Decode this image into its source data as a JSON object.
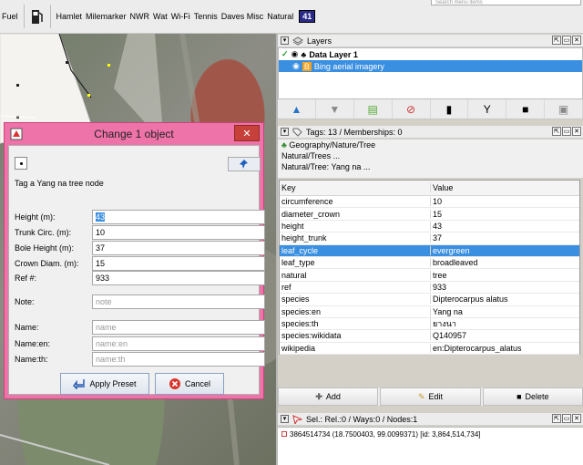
{
  "toolbar": {
    "items": [
      "Fuel",
      "Hamlet",
      "Milemarker",
      "NWR",
      "Wat",
      "Wi-Fi",
      "Tennis",
      "Daves Misc",
      "Natural"
    ],
    "badge": "41",
    "search_placeholder": "Search menu items"
  },
  "dialog": {
    "title": "Change 1 object",
    "close": "✕",
    "description": "Tag a Yang na tree node",
    "fields": [
      {
        "label": "Height (m):",
        "value": "43"
      },
      {
        "label": "Trunk Circ. (m):",
        "value": "10"
      },
      {
        "label": "Bole Height (m):",
        "value": "37"
      },
      {
        "label": "Crown Diam. (m):",
        "value": "15"
      },
      {
        "label": "Ref #:",
        "value": "933"
      }
    ],
    "note": {
      "label": "Note:",
      "placeholder": "note"
    },
    "names": [
      {
        "label": "Name:",
        "placeholder": "name"
      },
      {
        "label": "Name:en:",
        "placeholder": "name:en"
      },
      {
        "label": "Name:th:",
        "placeholder": "name:th"
      }
    ],
    "apply_label": "Apply Preset",
    "cancel_label": "Cancel"
  },
  "layers_panel": {
    "title": "Layers",
    "items": [
      {
        "label": "Data Layer 1",
        "selected": false
      },
      {
        "label": "Bing aerial imagery",
        "selected": true
      }
    ]
  },
  "tags_panel": {
    "title": "Tags: 13 / Memberships: 0",
    "preset_lines": [
      "Geography/Nature/Tree",
      "Natural/Trees ...",
      "Natural/Tree: Yang na ..."
    ],
    "columns": [
      "Key",
      "Value"
    ],
    "rows": [
      {
        "key": "circumference",
        "value": "10"
      },
      {
        "key": "diameter_crown",
        "value": "15"
      },
      {
        "key": "height",
        "value": "43"
      },
      {
        "key": "height_trunk",
        "value": "37"
      },
      {
        "key": "leaf_cycle",
        "value": "evergreen"
      },
      {
        "key": "leaf_type",
        "value": "broadleaved"
      },
      {
        "key": "natural",
        "value": "tree"
      },
      {
        "key": "ref",
        "value": "933"
      },
      {
        "key": "species",
        "value": "Dipterocarpus alatus"
      },
      {
        "key": "species:en",
        "value": "Yang na"
      },
      {
        "key": "species:th",
        "value": "ยางนา"
      },
      {
        "key": "species:wikidata",
        "value": "Q140957"
      },
      {
        "key": "wikipedia",
        "value": "en:Dipterocarpus_alatus"
      }
    ],
    "selected_row_index": 4,
    "add_label": "Add",
    "edit_label": "Edit",
    "delete_label": "Delete"
  },
  "selection_panel": {
    "title": "Sel.: Rel.:0 / Ways:0 / Nodes:1",
    "item": "3864514734 (18.7500403, 99.0099371) [id: 3,864,514,734]"
  },
  "colors": {
    "selection": "#3b8fe0",
    "dialog_frame": "#ee73a8",
    "close_button": "#c7413a"
  }
}
